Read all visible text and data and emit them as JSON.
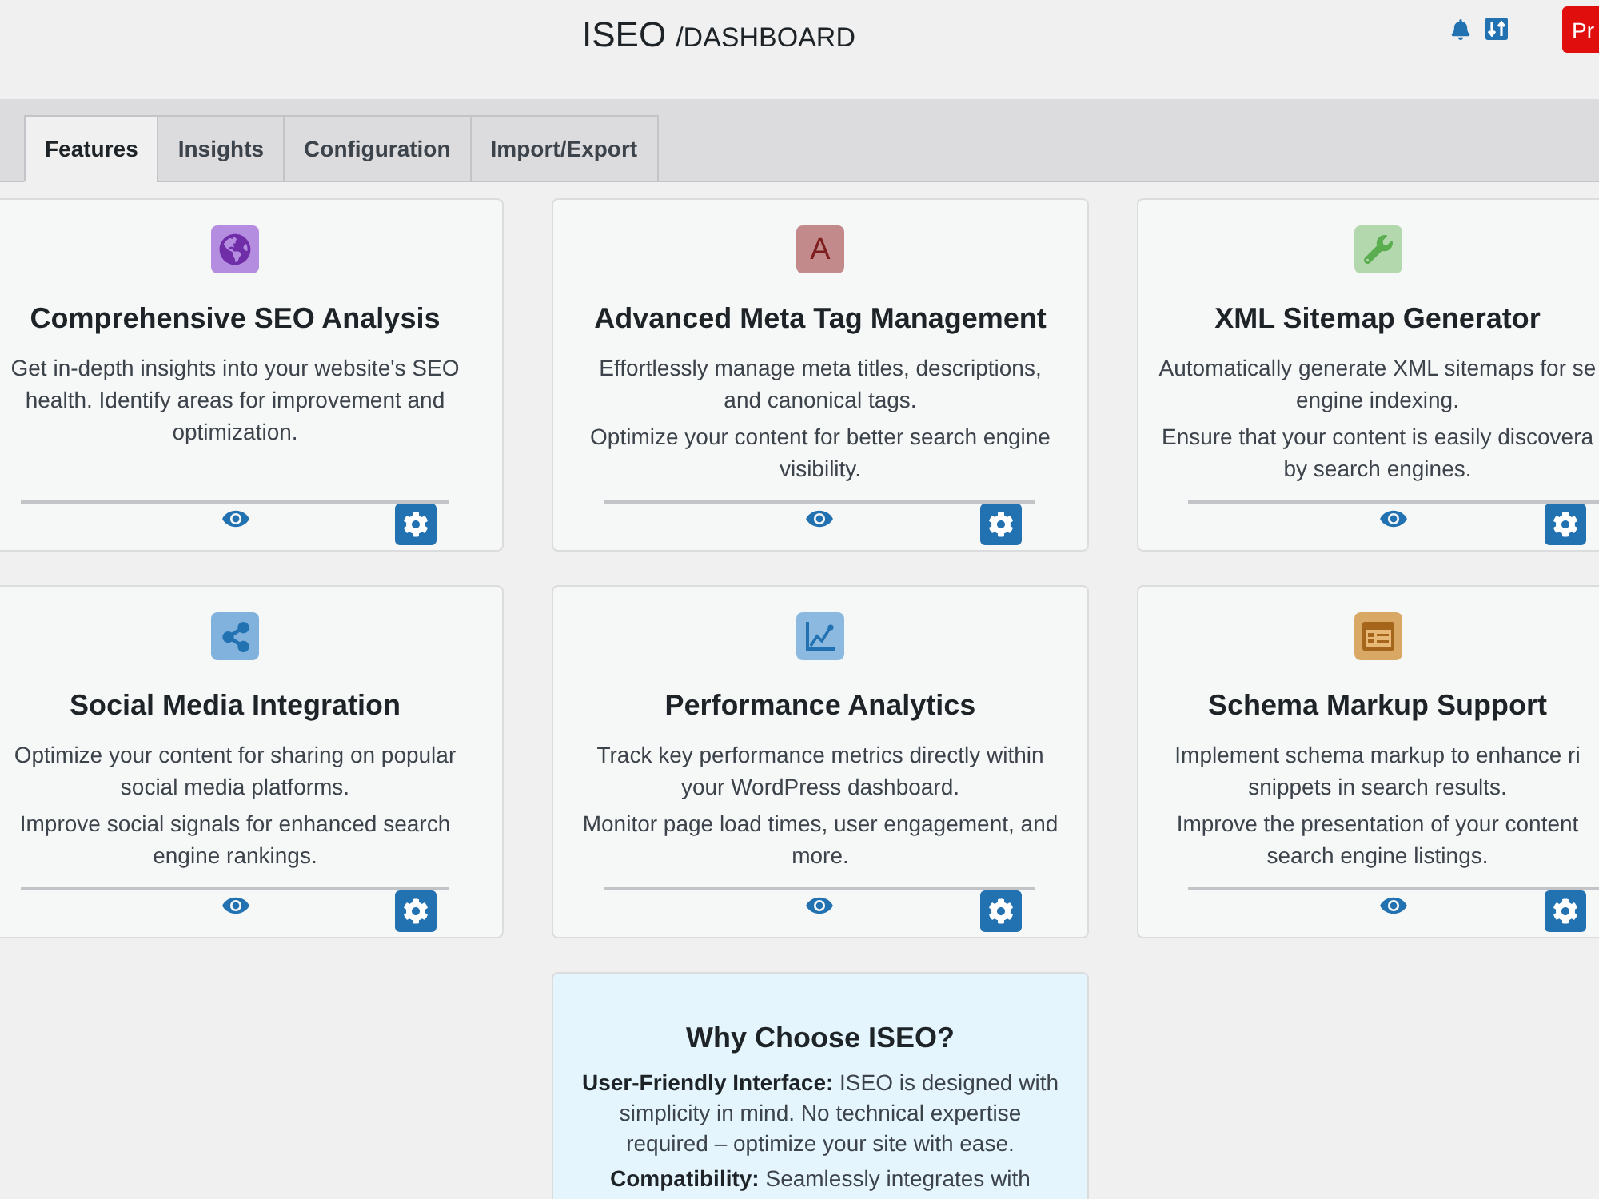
{
  "header": {
    "title": "ISEO",
    "subtitle": "/DASHBOARD",
    "action_button": "Pr"
  },
  "tabs": [
    {
      "label": "Features",
      "selected": true
    },
    {
      "label": "Insights",
      "selected": false
    },
    {
      "label": "Configuration",
      "selected": false
    },
    {
      "label": "Import/Export",
      "selected": false
    }
  ],
  "feature_cards": [
    {
      "title": "Comprehensive SEO Analysis",
      "paragraphs": [
        "Get in-depth insights into your website's SEO\nhealth. Identify areas for improvement and\noptimization."
      ]
    },
    {
      "icon_glyph": "A",
      "title": "Advanced Meta Tag Management",
      "paragraphs": [
        "Effortlessly manage meta titles, descriptions,\nand canonical tags.",
        "Optimize your content for better search engine\nvisibility."
      ]
    },
    {
      "title": "XML Sitemap Generator",
      "paragraphs": [
        "Automatically generate XML sitemaps for se\nengine indexing.",
        "Ensure that your content is easily discovera\nby search engines."
      ]
    },
    {
      "title": "Social Media Integration",
      "paragraphs": [
        "Optimize your content for sharing on popular\nsocial media platforms.",
        "Improve social signals for enhanced search\nengine rankings."
      ]
    },
    {
      "title": "Performance Analytics",
      "paragraphs": [
        "Track key performance metrics directly within\nyour WordPress dashboard.",
        "Monitor page load times, user engagement, and\nmore."
      ]
    },
    {
      "title": "Schema Markup Support",
      "paragraphs": [
        "Implement schema markup to enhance ri\nsnippets in search results.",
        "Improve the presentation of your content\nsearch engine listings."
      ]
    }
  ],
  "why_card": {
    "title": "Why Choose ISEO?",
    "paragraphs": [
      "**User-Friendly Interface:** ISEO is designed with\nsimplicity in mind. No technical expertise\nrequired – optimize your site with ease.",
      "**Compatibility:** Seamlessly integrates with"
    ]
  }
}
